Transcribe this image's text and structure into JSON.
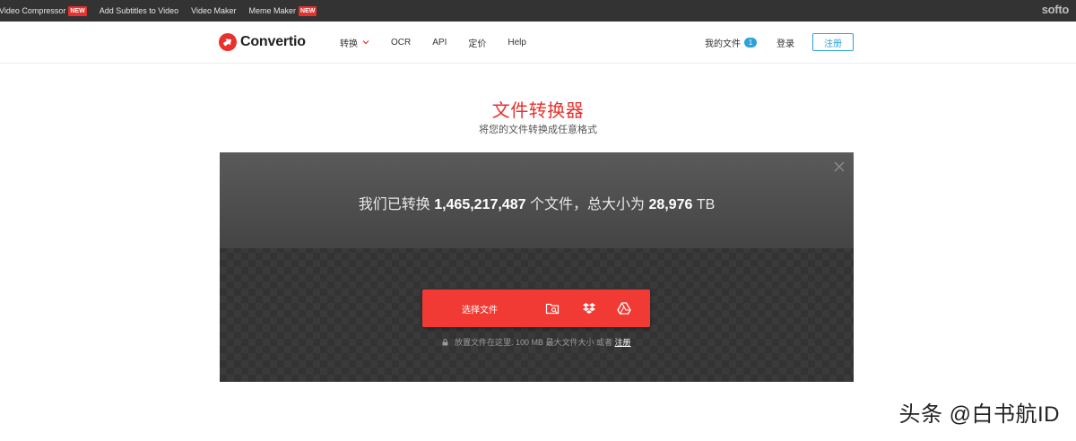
{
  "topbar": {
    "links": [
      {
        "label": "Video Compressor",
        "badge": "NEW"
      },
      {
        "label": "Add Subtitles to Video",
        "badge": ""
      },
      {
        "label": "Video Maker",
        "badge": ""
      },
      {
        "label": "Meme Maker",
        "badge": "NEW"
      }
    ],
    "brand": "softo"
  },
  "header": {
    "logo_text": "Convertio",
    "nav": [
      "转换",
      "OCR",
      "API",
      "定价",
      "Help"
    ],
    "my_files": "我的文件",
    "my_files_count": "1",
    "login": "登录",
    "register": "注册"
  },
  "hero": {
    "title": "文件转换器",
    "subtitle": "将您的文件转换成任意格式"
  },
  "stats": {
    "prefix": "我们已转换",
    "files_count": "1,465,217,487",
    "middle": "个文件，总大小为",
    "total_size": "28,976",
    "unit": "TB"
  },
  "upload": {
    "choose_label": "选择文件",
    "sources": [
      "folder-search-icon",
      "dropbox-icon",
      "google-drive-icon"
    ],
    "hint_text": "放置文件在这里. 100 MB 最大文件大小 或者",
    "hint_link": "注册"
  },
  "watermark": "头条 @白书航ID",
  "colors": {
    "accent_red": "#e8312e",
    "button_red": "#f23a35",
    "blue": "#2ea1d8",
    "topbar": "#333333"
  }
}
